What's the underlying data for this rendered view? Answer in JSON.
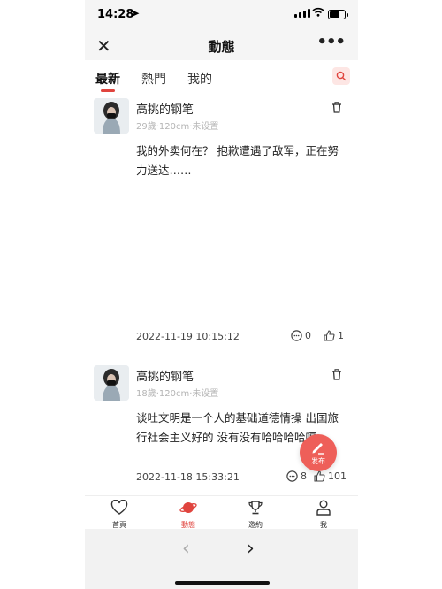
{
  "status_bar": {
    "time": "14:28"
  },
  "header": {
    "title": "動態"
  },
  "tabs": [
    {
      "label": "最新"
    },
    {
      "label": "熱門"
    },
    {
      "label": "我的"
    }
  ],
  "posts": [
    {
      "name": "高挑的钢笔",
      "meta": "29歲·120cm·未设置",
      "content": "我的外卖何在？  抱歉遭遇了敌军，正在努力送达……",
      "date": "2022-11-19 10:15:12",
      "comments": "0",
      "likes": "1"
    },
    {
      "name": "高挑的钢笔",
      "meta": "18歲·120cm·未设置",
      "content": "谈吐文明是一个人的基础道德情操  出国旅行社会主义好的  没有没有哈哈哈哈嗝",
      "date": "2022-11-18 15:33:21",
      "comments": "8",
      "likes": "101"
    }
  ],
  "fab": {
    "label": "发布"
  },
  "bottom_nav": [
    {
      "label": "首頁",
      "icon": "heart-chat-icon"
    },
    {
      "label": "動態",
      "icon": "planet-icon"
    },
    {
      "label": "邀約",
      "icon": "trophy-icon"
    },
    {
      "label": "我",
      "icon": "person-icon"
    }
  ],
  "colors": {
    "accent": "#e0443e",
    "fab": "#ee5f59",
    "bar_bg": "#f5f5f5"
  }
}
